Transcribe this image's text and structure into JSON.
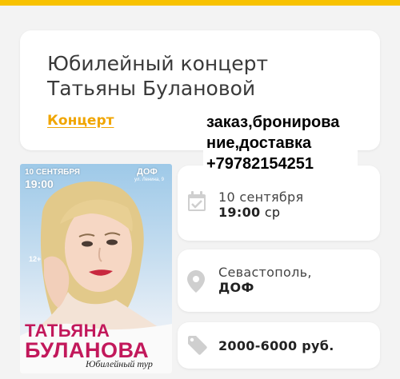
{
  "event": {
    "title_line1": "Юбилейный концерт",
    "title_line2": "Татьяны Булановой",
    "category": "Концерт"
  },
  "overlay": {
    "line1": "заказ,бронирова",
    "line2": "ние,доставка",
    "line3": "+79782154251"
  },
  "poster": {
    "date": "10 СЕНТЯБРЯ",
    "time": "19:00",
    "venue": "ДОФ",
    "address": "ул. Ленина, 9",
    "age": "12+",
    "name1": "ТАТЬЯНА",
    "name2": "БУЛАНОВА",
    "tour": "Юбилейный тур"
  },
  "details": {
    "date": "10 сентября",
    "time": "19:00",
    "weekday": "ср",
    "city": "Севастополь,",
    "venue": "ДОФ",
    "price": "2000-6000 руб."
  },
  "icons": {
    "date": "calendar-icon",
    "place": "location-pin-icon",
    "price": "price-tag-icon"
  },
  "colors": {
    "accent": "#f8c200",
    "link": "#f0a500",
    "icon": "#cfcfcf",
    "background": "#f3f3f3"
  }
}
